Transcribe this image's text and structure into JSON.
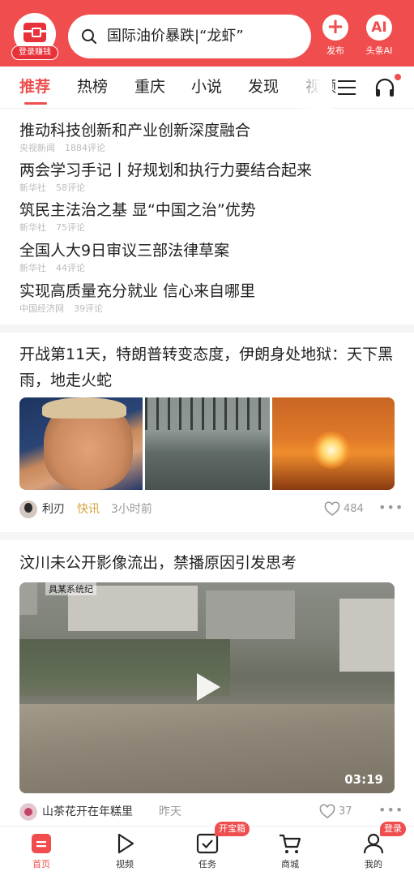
{
  "header": {
    "logo_tag": "登录赚钱",
    "search": {
      "text": "国际油价暴跌|“龙虾”"
    },
    "publish_label": "发布",
    "ai_label": "头条AI",
    "ai_glyph": "AI",
    "plus_glyph": "+"
  },
  "tabs": [
    {
      "label": "推荐",
      "active": true
    },
    {
      "label": "热榜"
    },
    {
      "label": "重庆"
    },
    {
      "label": "小说"
    },
    {
      "label": "发现"
    },
    {
      "label": "视频"
    }
  ],
  "news": [
    {
      "title": "推动科技创新和产业创新深度融合",
      "source": "央视新闻",
      "comments": "1884评论"
    },
    {
      "title": "两会学习手记丨好规划和执行力要结合起来",
      "source": "新华社",
      "comments": "58评论"
    },
    {
      "title": "筑民主法治之基 显“中国之治”优势",
      "source": "新华社",
      "comments": "75评论"
    },
    {
      "title": "全国人大9日审议三部法律草案",
      "source": "新华社",
      "comments": "44评论"
    },
    {
      "title": "实现高质量充分就业 信心来自哪里",
      "source": "中国经济网",
      "comments": "39评论"
    }
  ],
  "article1": {
    "title": "开战第11天，特朗普转变态度，伊朗身处地狱：天下黑雨，地走火蛇",
    "author": "利刃",
    "tag": "快讯",
    "time": "3小时前",
    "likes": "484"
  },
  "article2": {
    "title": "汶川未公开影像流出，禁播原因引发思考",
    "author": "山茶花开在年糕里",
    "time": "昨天",
    "likes": "37",
    "duration": "03:19",
    "watermark": "具某系统纪"
  },
  "bottom_nav": [
    {
      "label": "首页",
      "active": true
    },
    {
      "label": "视频"
    },
    {
      "label": "任务",
      "badge": "开宝箱"
    },
    {
      "label": "商城"
    },
    {
      "label": "我的",
      "badge": "登录"
    }
  ],
  "colors": {
    "brand": "#f04e4e",
    "tag": "#d7a33a"
  }
}
